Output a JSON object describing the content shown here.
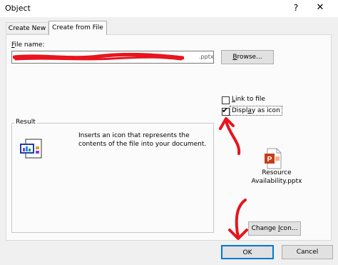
{
  "window": {
    "title": "Object",
    "help_label": "?",
    "close_label": "✕"
  },
  "tabs": [
    {
      "label": "Create New",
      "active": false
    },
    {
      "label": "Create from File",
      "active": true
    }
  ],
  "file_name": {
    "label": "File name:",
    "value_visible_suffix": ".pptx",
    "redacted": true
  },
  "browse_button": "Browse...",
  "options": {
    "link_to_file": {
      "label": "Link to file",
      "checked": false
    },
    "display_as_icon": {
      "label": "Display as icon",
      "checked": true
    }
  },
  "result": {
    "legend": "Result",
    "description": "Inserts an icon that represents the contents of the file into your document."
  },
  "preview_icon": {
    "icon": "powerpoint-file-icon",
    "label_line1": "Resource",
    "label_line2": "Availability.pptx"
  },
  "change_icon_button": "Change Icon...",
  "ok_button": "OK",
  "cancel_button": "Cancel",
  "colors": {
    "annotation_red": "#e8141e",
    "ok_border": "#0078d7",
    "ppt_orange": "#c43e1c"
  }
}
